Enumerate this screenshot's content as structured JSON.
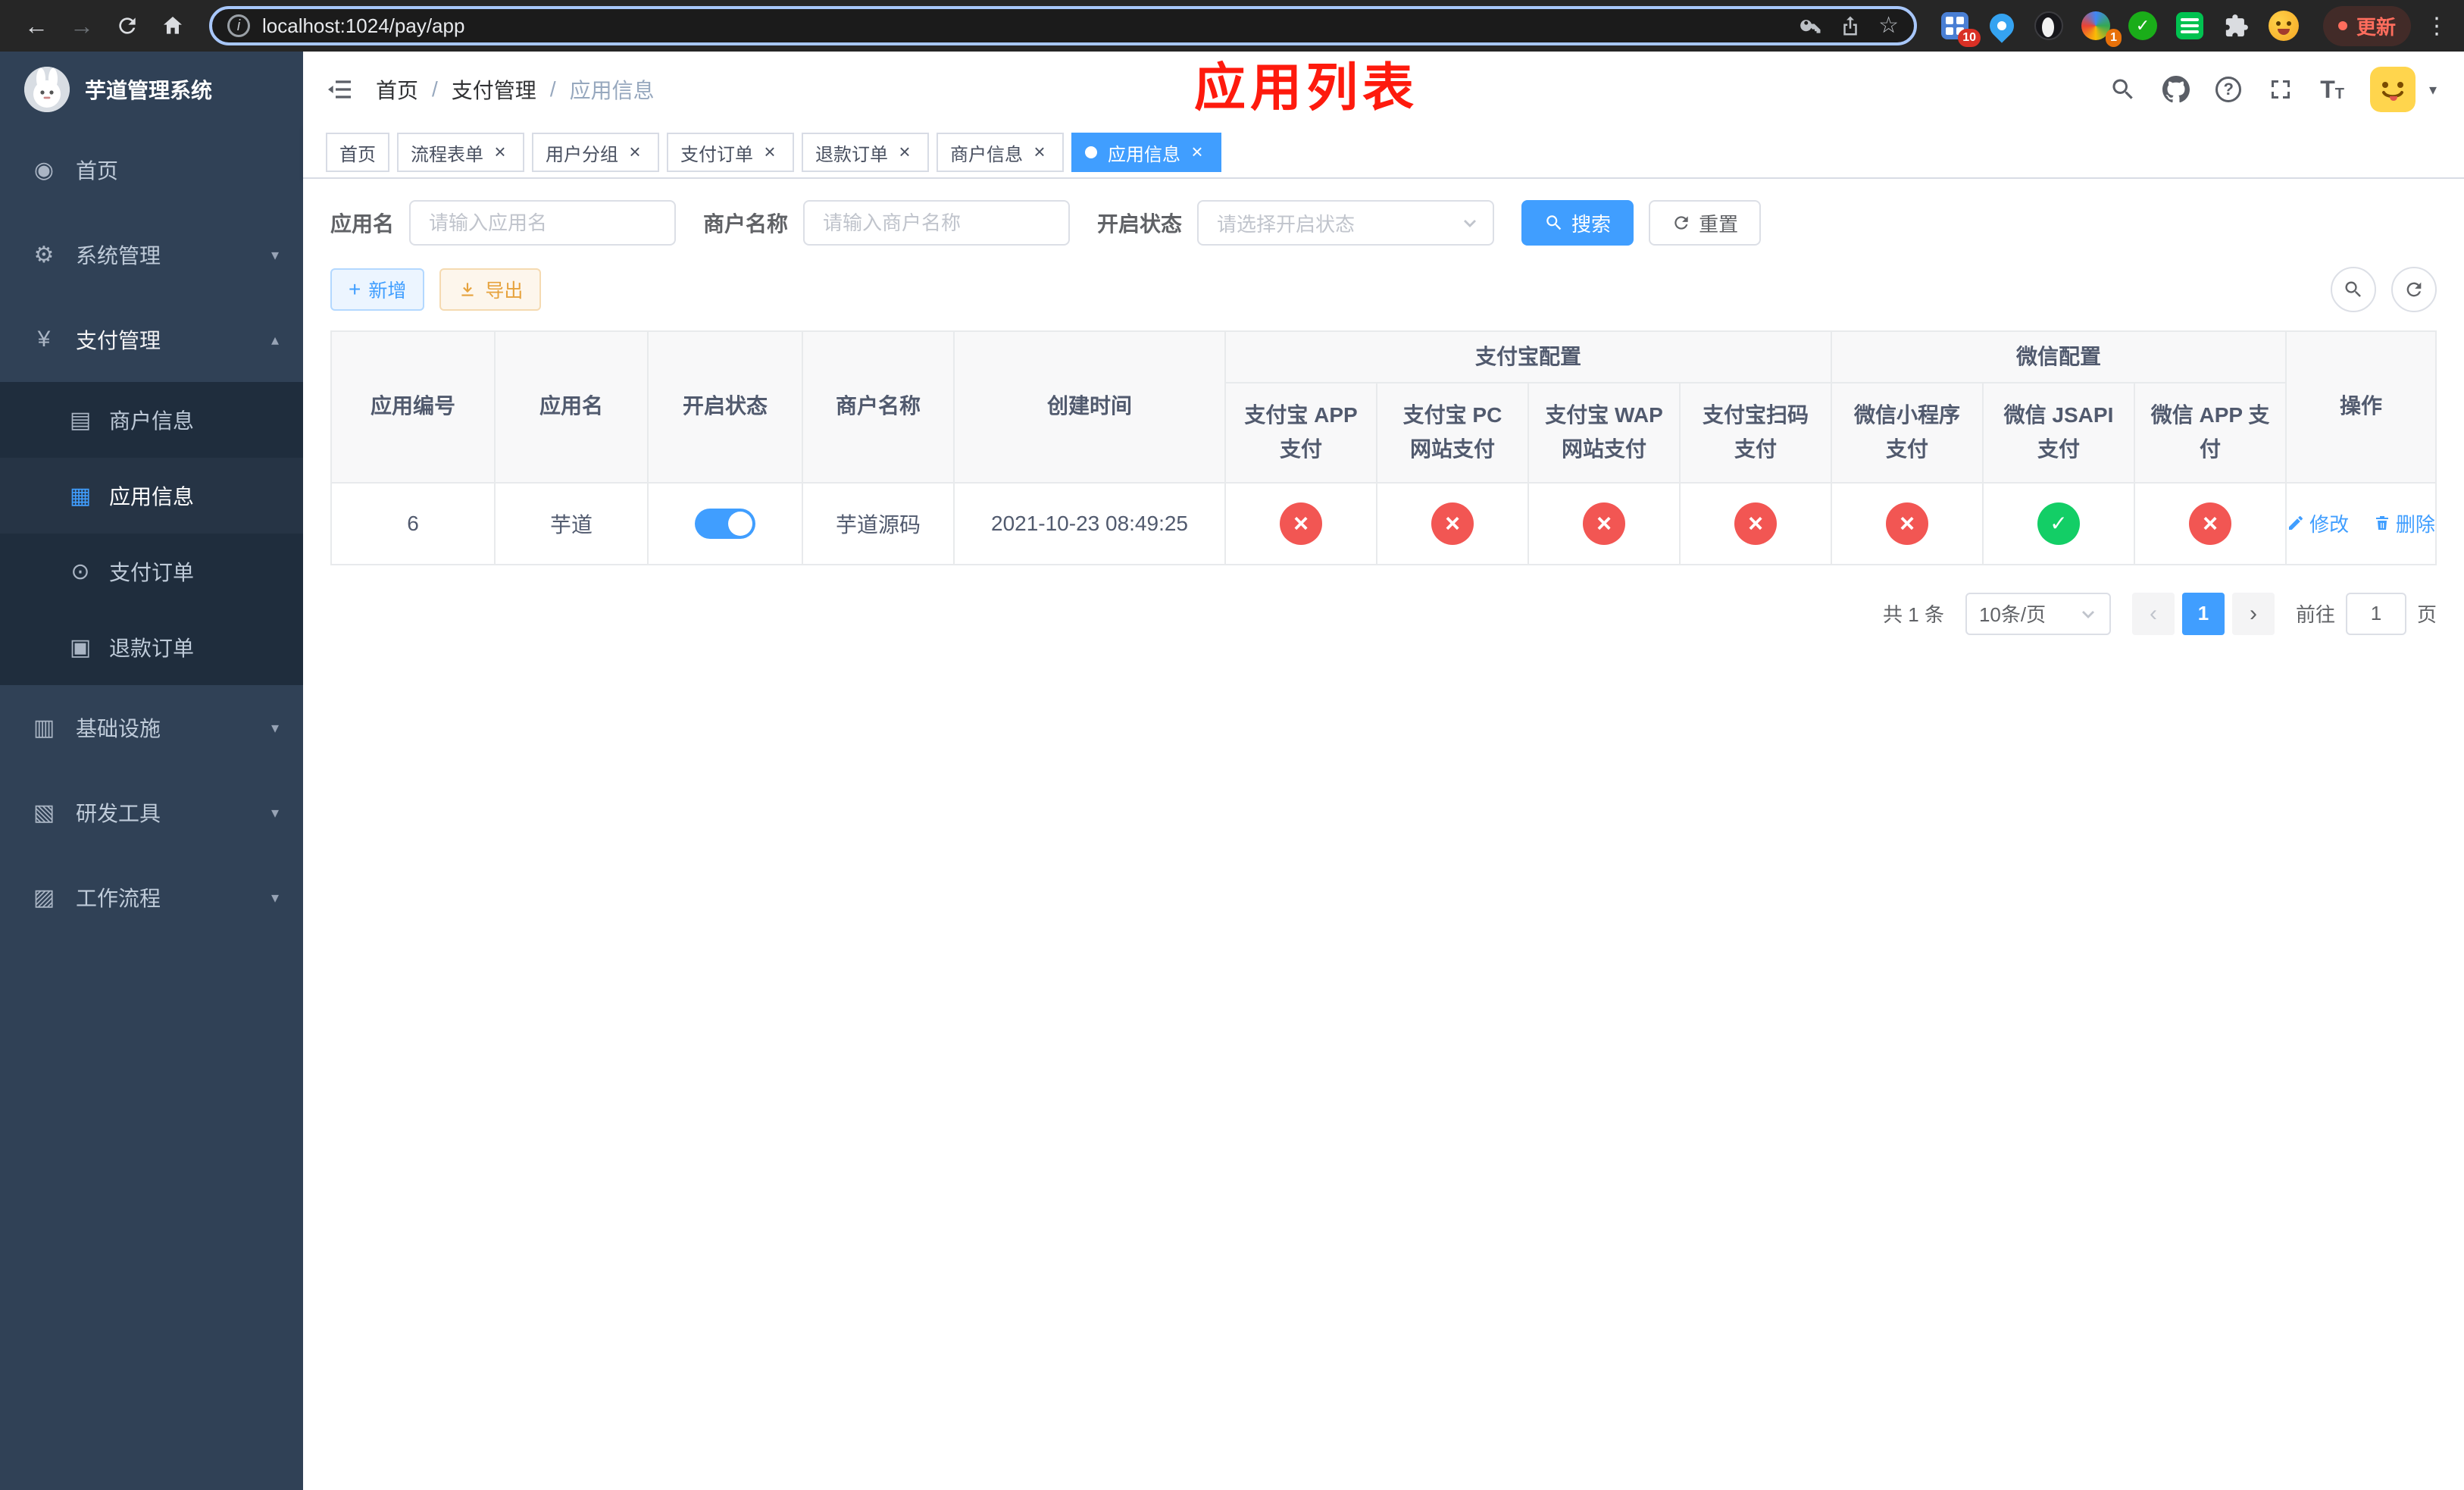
{
  "glyphs": {
    "back": "←",
    "forward": "→",
    "star": "☆",
    "kebab": "⋮",
    "info": "i",
    "question": "?",
    "caret_down": "▾",
    "caret_up": "▴",
    "close": "×",
    "plus": "+",
    "prev": "‹",
    "next": "›",
    "font_big": "T",
    "font_small": "T",
    "dashboard": "◉",
    "gear": "⚙",
    "yen": "¥",
    "card": "▤",
    "grid": "▦",
    "order": "⊙",
    "refund": "▣",
    "infra": "▥",
    "tools": "▧",
    "flow": "▨"
  },
  "colors": {
    "accent": "#409eff",
    "danger": "#f25653",
    "success": "#13ce66",
    "annotation": "#fe1a0d",
    "sidebar_bg": "#304156",
    "submenu_bg": "#1f2d3d"
  },
  "browser": {
    "url": "localhost:1024/pay/app",
    "update_label": "更新",
    "ext_badge_1": "10",
    "ext_badge_2": "1"
  },
  "sidebar": {
    "logo_title": "芋道管理系统",
    "home": "首页",
    "system": "系统管理",
    "payment": "支付管理",
    "merchant_info": "商户信息",
    "app_info": "应用信息",
    "pay_order": "支付订单",
    "refund_order": "退款订单",
    "infrastructure": "基础设施",
    "dev_tools": "研发工具",
    "workflow": "工作流程"
  },
  "breadcrumb": {
    "home": "首页",
    "sep": "/",
    "section": "支付管理",
    "current": "应用信息"
  },
  "annotation": {
    "title": "应用列表"
  },
  "tabs": [
    {
      "label": "首页"
    },
    {
      "label": "流程表单"
    },
    {
      "label": "用户分组"
    },
    {
      "label": "支付订单"
    },
    {
      "label": "退款订单"
    },
    {
      "label": "商户信息"
    },
    {
      "label": "应用信息",
      "active": true
    }
  ],
  "filters": {
    "app_name_label": "应用名",
    "app_name_placeholder": "请输入应用名",
    "merchant_label": "商户名称",
    "merchant_placeholder": "请输入商户名称",
    "status_label": "开启状态",
    "status_placeholder": "请选择开启状态",
    "search_label": "搜索",
    "reset_label": "重置"
  },
  "toolbar": {
    "add_label": "新增",
    "export_label": "导出"
  },
  "table": {
    "headers": {
      "app_id": "应用编号",
      "app_name": "应用名",
      "status": "开启状态",
      "merchant": "商户名称",
      "created": "创建时间",
      "alipay_group": "支付宝配置",
      "wechat_group": "微信配置",
      "alipay_app": "支付宝 APP 支付",
      "alipay_pc": "支付宝 PC 网站支付",
      "alipay_wap": "支付宝 WAP 网站支付",
      "alipay_qr": "支付宝扫码支付",
      "wx_mini": "微信小程序支付",
      "wx_jsapi": "微信 JSAPI 支付",
      "wx_app": "微信 APP 支付",
      "actions": "操作"
    },
    "row": {
      "app_id": "6",
      "app_name": "芋道",
      "status": "true",
      "merchant": "芋道源码",
      "created": "2021-10-23 08:49:25",
      "channels": [
        "no",
        "no",
        "no",
        "no",
        "no",
        "yes",
        "no"
      ],
      "edit_label": "修改",
      "delete_label": "删除"
    }
  },
  "pagination": {
    "total": "共 1 条",
    "page_size": "10条/页",
    "page": "1",
    "goto_label": "前往",
    "goto_value": "1",
    "page_suffix": "页"
  }
}
